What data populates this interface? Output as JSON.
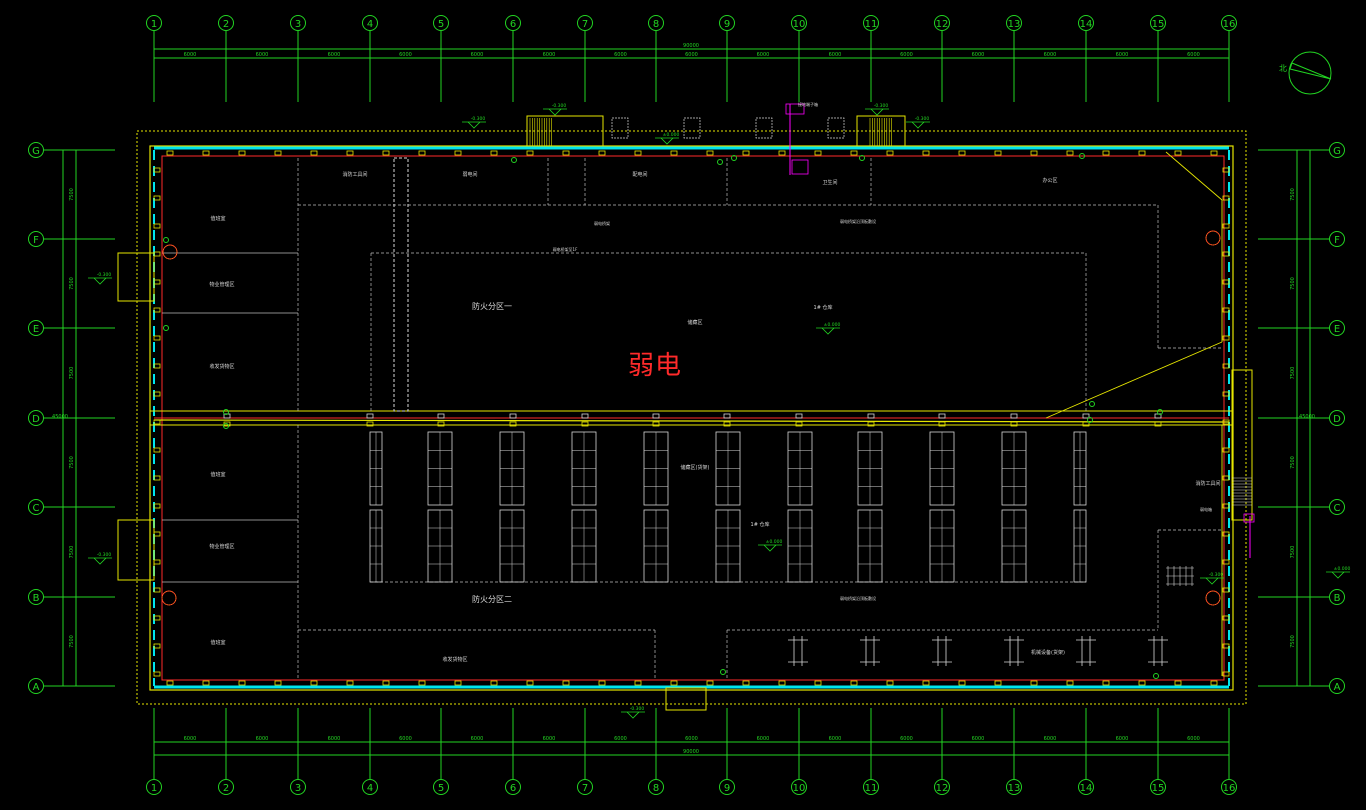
{
  "drawing": {
    "watermark_label": "弱电",
    "column_axes": [
      "1",
      "2",
      "3",
      "4",
      "5",
      "6",
      "7",
      "8",
      "9",
      "10",
      "11",
      "12",
      "13",
      "14",
      "15",
      "16"
    ],
    "row_axes": [
      "G",
      "F",
      "E",
      "D",
      "C",
      "B",
      "A"
    ],
    "bay_dims_top": [
      "6000",
      "6000",
      "6000",
      "6000",
      "6000",
      "6000",
      "6000",
      "6000",
      "6000",
      "6000",
      "6000",
      "6000",
      "6000",
      "6000",
      "6000"
    ],
    "bay_dims_bottom": [
      "6000",
      "6000",
      "6000",
      "6000",
      "6000",
      "6000",
      "6000",
      "6000",
      "6000",
      "6000",
      "6000",
      "6000",
      "6000",
      "6000",
      "6000"
    ],
    "total_dim_top": "90000",
    "total_dim_bottom": "90000",
    "row_dims_left": [
      "7500",
      "7500",
      "7500",
      "7500",
      "7500",
      "7500"
    ],
    "row_dims_right": [
      "7500",
      "7500",
      "7500",
      "7500",
      "7500",
      "7500"
    ],
    "total_dim_left": "45000",
    "total_dim_right": "45000",
    "north_label": "北",
    "zones": {
      "zone1": "防火分区一",
      "zone2": "防火分区二",
      "area_upper": "1# 仓库",
      "area_lower": "1# 仓库",
      "storage_upper": "储藏区",
      "storage_lower": "储藏区(货架)",
      "office_left_1": "值班室",
      "office_left_2": "物业管理区",
      "office_left_3": "收发货物区",
      "office_left_4": "值班室",
      "office_left_5": "物业管理区",
      "office_left_6": "值班室",
      "room_top_1": "消防工具间",
      "room_top_2": "弱电间",
      "room_top_3": "配电间",
      "room_top_4": "卫生间",
      "room_top_5": "办公区",
      "room_bottom_1": "收发货物区",
      "room_bottom_2": "机械设备(货架)",
      "room_right_1": "消防工具间"
    },
    "annotations": {
      "note_top": "接地端子箱",
      "note_weak_1": "弱电桥架",
      "note_weak_2": "弱电桥架至1F",
      "note_upper_trunk": "弱电桥架沿顶板敷设",
      "note_lower_trunk": "弱电桥架沿顶板敷设",
      "note_right_panel": "弱电箱"
    },
    "elevations": {
      "el_top_left": "-0.300",
      "el_top_mid": "±0.000",
      "el_top_right": "-0.300",
      "el_left_upper": "-0.300",
      "el_left_lower": "-0.300",
      "el_center_upper": "±0.000",
      "el_center_lower": "±0.000",
      "el_bottom": "-0.300",
      "el_right": "-0.300",
      "el_far_right": "±0.000"
    }
  }
}
